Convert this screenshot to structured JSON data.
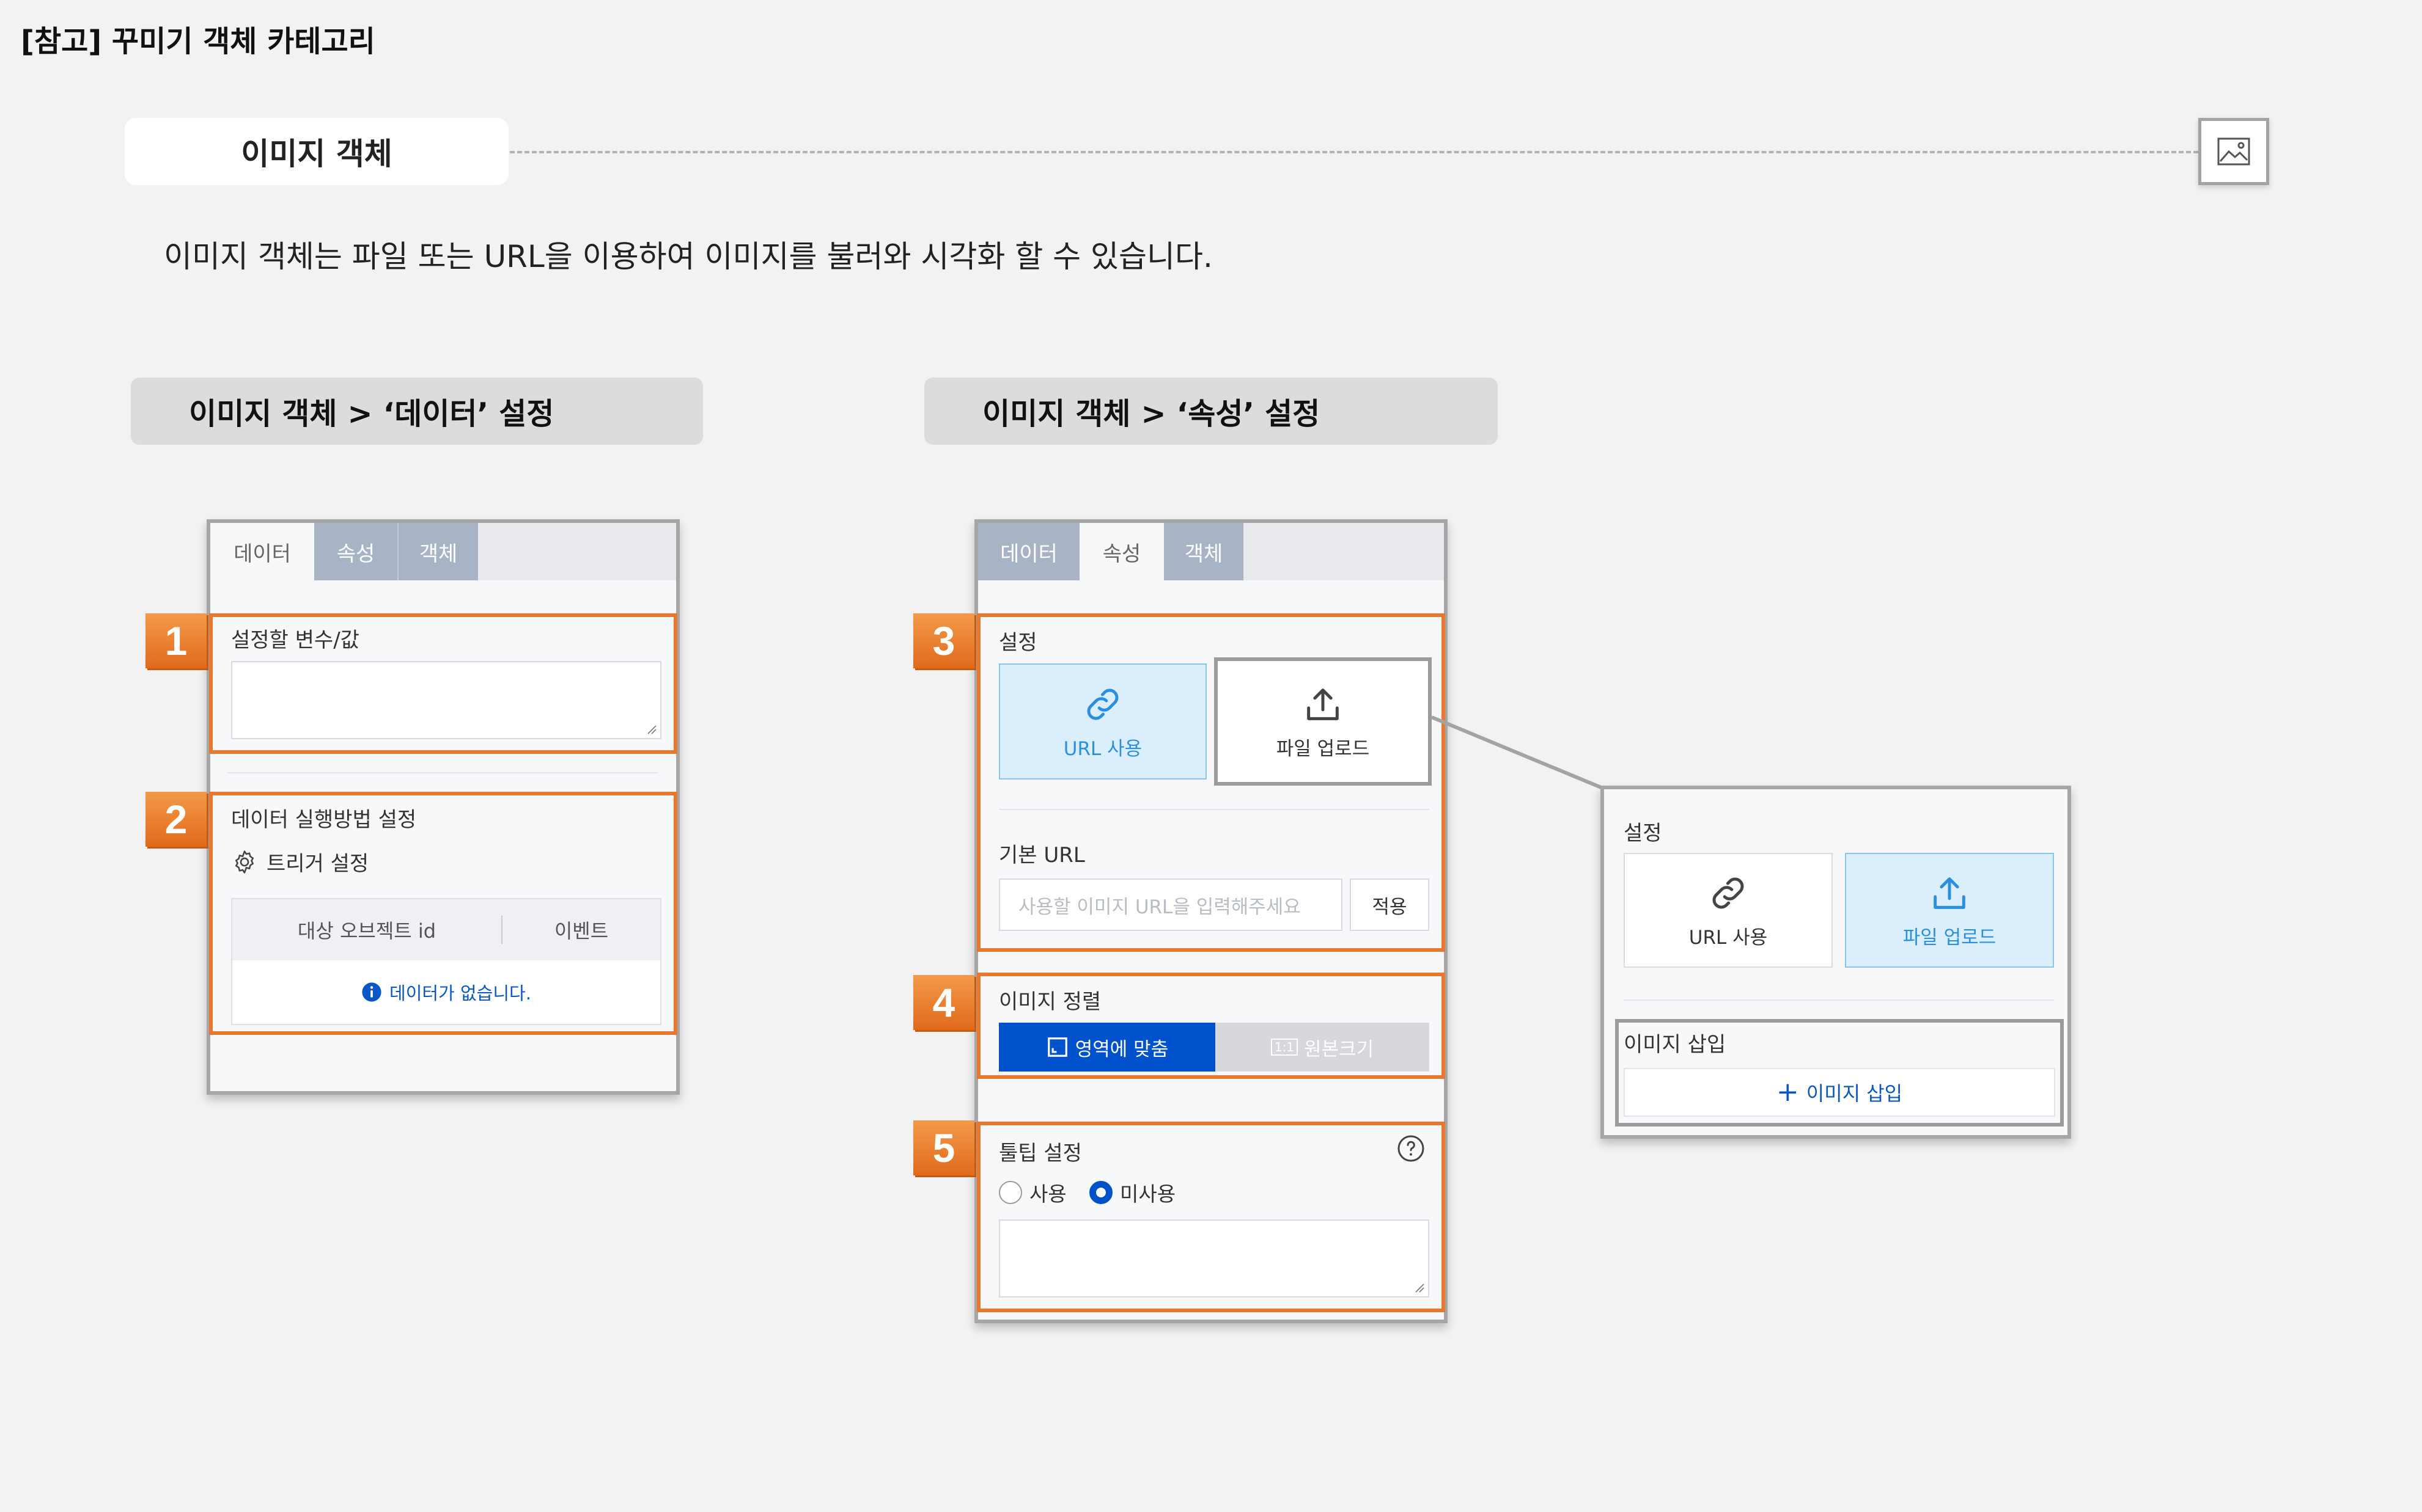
{
  "header": {
    "title": "[참고] 꾸미기 객체 카테고리"
  },
  "object": {
    "name": "이미지 객체",
    "icon": "image-icon",
    "description": "이미지 객체는 파일 또는 URL을 이용하여 이미지를 불러와 시각화 할 수 있습니다."
  },
  "sections": {
    "data_title": "이미지 객체 > ‘데이터’ 설정",
    "prop_title": "이미지 객체 > ‘속성’ 설정"
  },
  "tabs": [
    "데이터",
    "속성",
    "객체"
  ],
  "badges": [
    "1",
    "2",
    "3",
    "4",
    "5"
  ],
  "data_panel": {
    "var_label": "설정할 변수/값",
    "exec_label": "데이터 실행방법 설정",
    "trigger_label": "트리거 설정",
    "table_headers": [
      "대상 오브젝트 id",
      "이벤트"
    ],
    "empty_msg": "데이터가 없습니다."
  },
  "prop_panel": {
    "setting_label": "설정",
    "url_option": "URL 사용",
    "upload_option": "파일 업로드",
    "base_url_label": "기본 URL",
    "url_placeholder": "사용할 이미지 URL을 입력해주세요",
    "apply_button": "적용",
    "align_label": "이미지 정렬",
    "align_fit": "영역에 맞춤",
    "align_original": "원본크기",
    "align_original_icon": "1:1",
    "tooltip_label": "툴팁 설정",
    "radio_use": "사용",
    "radio_unused": "미사용"
  },
  "upload_panel": {
    "setting_label": "설정",
    "url_option": "URL 사용",
    "upload_option": "파일 업로드",
    "insert_label": "이미지 삽입",
    "insert_button": "이미지 삽입"
  },
  "colors": {
    "accent_orange": "#e87830",
    "primary_blue": "#0052cc",
    "light_blue": "#dbeefc",
    "link_blue": "#2b8fe0"
  }
}
